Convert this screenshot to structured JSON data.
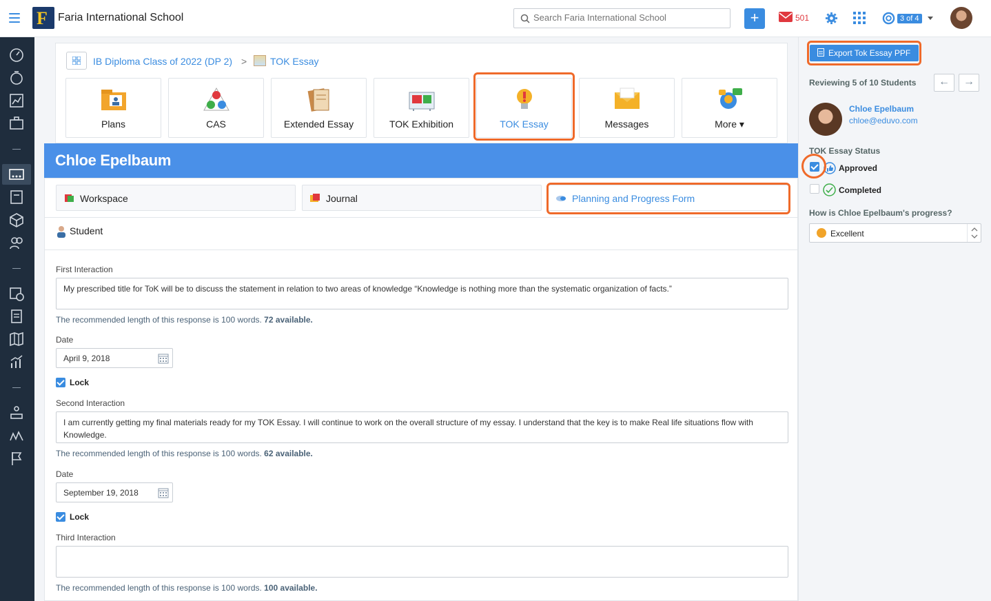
{
  "topbar": {
    "logo_letter": "F",
    "school_name": "Faria International School",
    "search_placeholder": "Search Faria International School",
    "add_label": "+",
    "mail_count": "501",
    "help_badge": "3 of 4"
  },
  "breadcrumb": {
    "class_link": "IB Diploma Class of 2022 (DP 2)",
    "separator": ">",
    "current": "TOK Essay"
  },
  "tiles": [
    {
      "label": "Plans",
      "icon": "plans-icon"
    },
    {
      "label": "CAS",
      "icon": "cas-icon"
    },
    {
      "label": "Extended Essay",
      "icon": "extended-essay-icon"
    },
    {
      "label": "TOK Exhibition",
      "icon": "tok-exhibition-icon"
    },
    {
      "label": "TOK Essay",
      "icon": "lightbulb-icon"
    },
    {
      "label": "Messages",
      "icon": "envelope-icon"
    },
    {
      "label": "More ▾",
      "icon": "more-icon"
    }
  ],
  "student": {
    "name": "Chloe Epelbaum",
    "section_title": "Student"
  },
  "subtabs": [
    {
      "label": "Workspace"
    },
    {
      "label": "Journal"
    },
    {
      "label": "Planning and Progress Form"
    }
  ],
  "form": {
    "first_label": "First Interaction",
    "first_text": "My prescribed title for ToK will be to discuss the statement in relation to two areas of knowledge “Knowledge is nothing more than the systematic organization of facts.”",
    "first_hint": "The recommended length of this response is 100 words.",
    "first_available": "72 available.",
    "date_label": "Date",
    "first_date": "April 9, 2018",
    "lock_label": "Lock",
    "second_label": "Second Interaction",
    "second_text": "I am currently getting my final materials ready for my TOK Essay. I will continue to work on the overall structure of  my essay. I understand that the key is to make Real life situations flow with Knowledge.",
    "second_hint": "The recommended length of this response is 100 words.",
    "second_available": "62 available.",
    "second_date": "September 19, 2018",
    "third_label": "Third Interaction",
    "third_text": "",
    "third_hint": "The recommended length of this response is 100 words.",
    "third_available": "100 available."
  },
  "sidebar": {
    "export_label": "Export Tok Essay PPF",
    "reviewing": "Reviewing 5 of 10 Students",
    "prev": "←",
    "next": "→",
    "student_name": "Chloe Epelbaum",
    "student_email": "chloe@eduvo.com",
    "status_label": "TOK Essay Status",
    "approved_label": "Approved",
    "completed_label": "Completed",
    "progress_question": "How is Chloe Epelbaum's progress?",
    "progress_value": "Excellent"
  },
  "colors": {
    "accent": "#3a8ce0",
    "highlight": "#ef6a2a",
    "nav_bg": "#1f2d3d",
    "student_bar": "#4a90e8"
  }
}
